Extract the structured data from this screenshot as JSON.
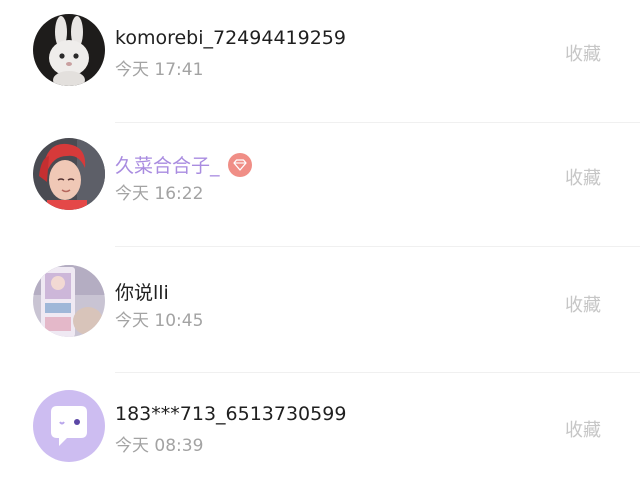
{
  "action_color": "#c6c6c6",
  "vip_name_color": "#a98ce0",
  "favorites": [
    {
      "avatar": "white-plush-bunny-avatar",
      "username": "komorebi_72494419259",
      "time": "今天 17:41",
      "action": "收藏"
    },
    {
      "avatar": "red-hair-person-avatar",
      "username": "久菜合合子_",
      "vip_badge": "diamond-icon",
      "time": "今天 16:22",
      "action": "收藏"
    },
    {
      "avatar": "photo-card-avatar",
      "username": "你说lli",
      "time": "今天 10:45",
      "action": "收藏"
    },
    {
      "avatar": "purple-chat-bubble-avatar",
      "username": "183***713_6513730599",
      "time": "今天 08:39",
      "action": "收藏"
    }
  ]
}
